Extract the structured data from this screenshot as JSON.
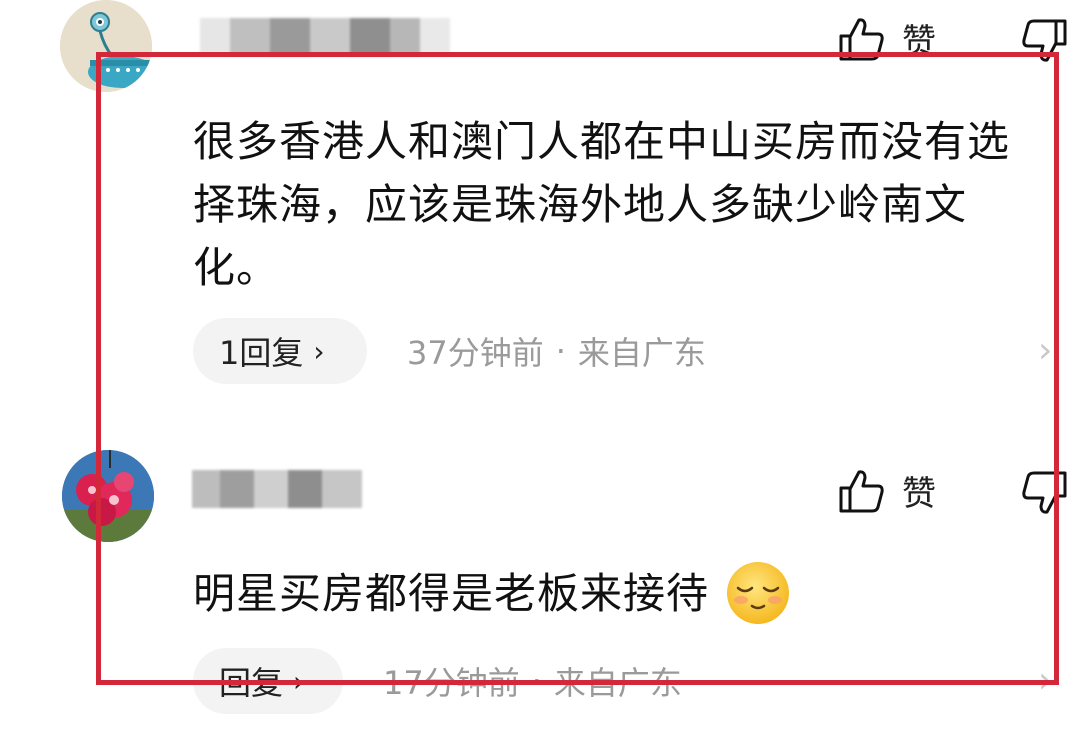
{
  "comments": [
    {
      "avatar_icon": "cartoon-avatar-icon",
      "like_label": "赞",
      "text": "很多香港人和澳门人都在中山买房而没有选择珠海，应该是珠海外地人多缺少岭南文化。",
      "reply_label": "1回复",
      "time": "37分钟前",
      "separator": "·",
      "location": "来自广东"
    },
    {
      "avatar_icon": "flower-avatar-icon",
      "like_label": "赞",
      "text": "明星买房都得是老板来接待",
      "emoji": "shy-smile-emoji",
      "reply_label": "回复",
      "time": "17分钟前",
      "separator": "·",
      "location": "来自广东"
    }
  ],
  "icons": {
    "like": "thumbs-up-icon",
    "dislike": "thumbs-down-icon",
    "reply_chevron": "›",
    "more_chevron": "›"
  },
  "colors": {
    "highlight_border": "#d2283a",
    "meta_text": "#9a9a9a",
    "reply_bg": "#f3f3f3"
  }
}
